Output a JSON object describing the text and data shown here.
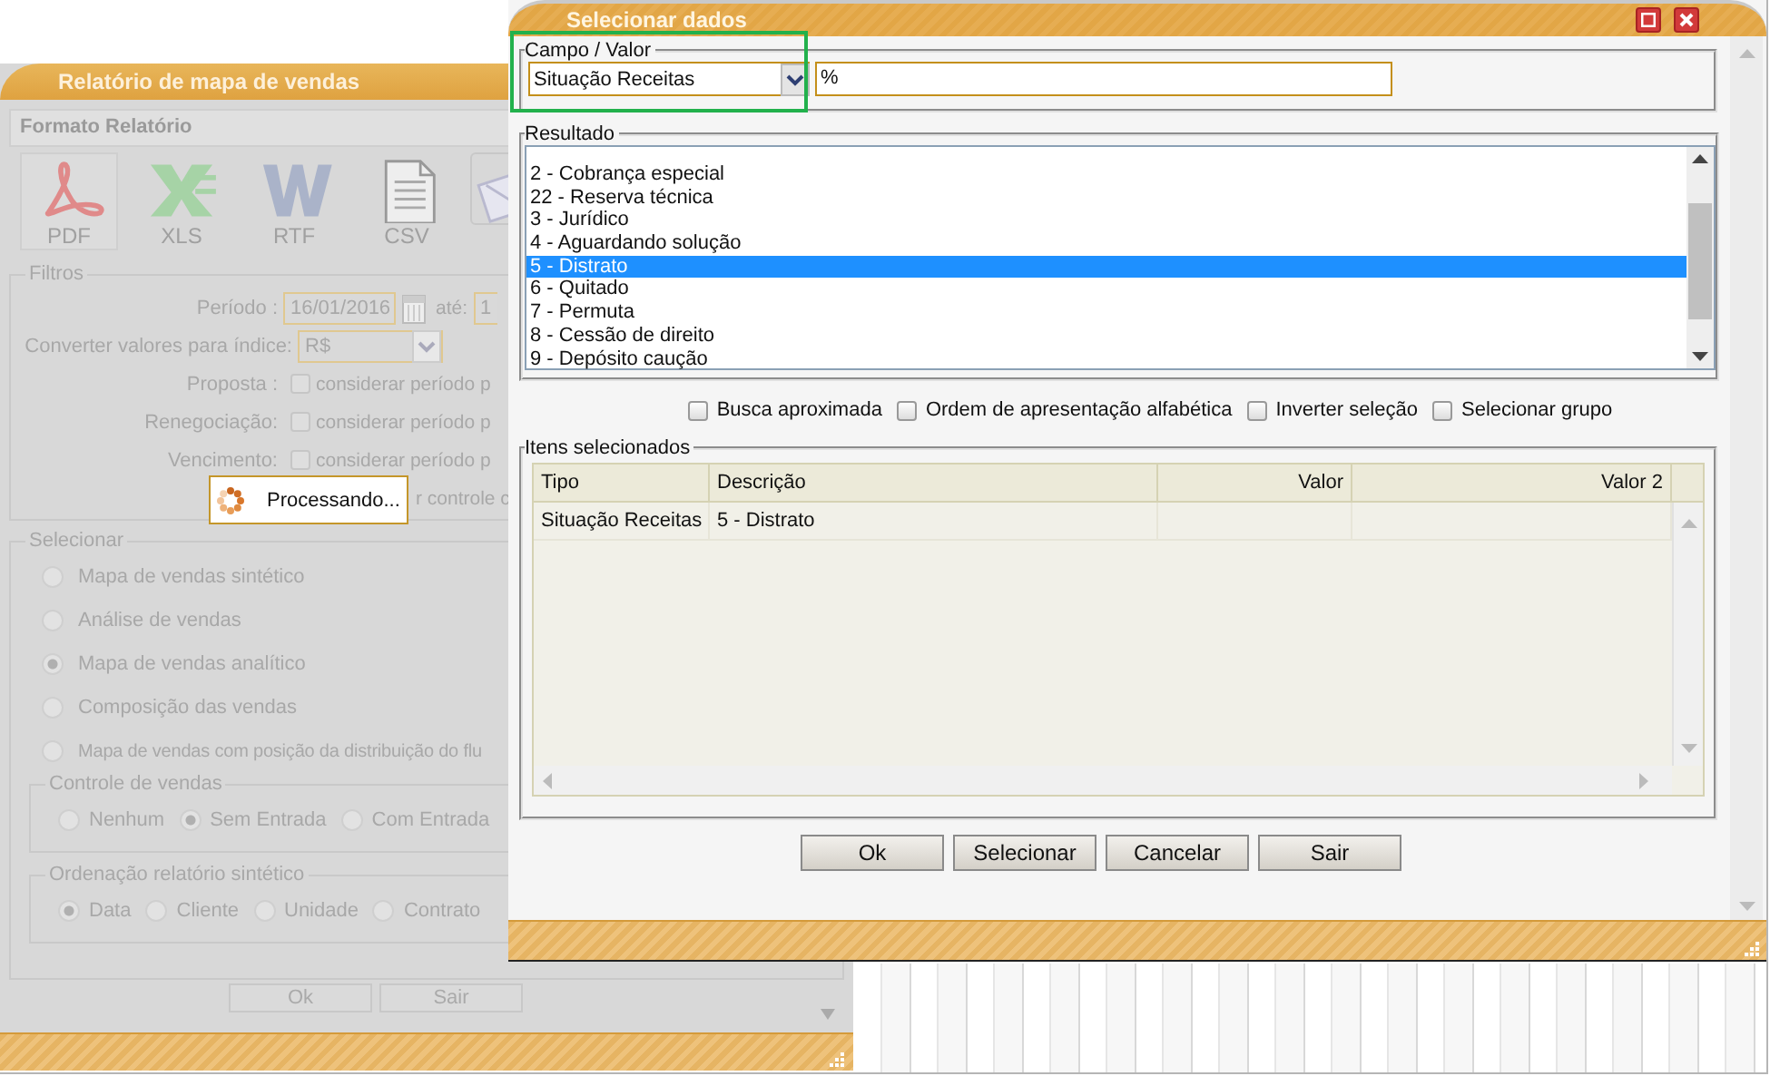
{
  "background_window": {
    "title": "Relatório de mapa de vendas",
    "format_section": {
      "title": "Formato Relatório",
      "formats": [
        {
          "kind": "pdf",
          "label": "PDF"
        },
        {
          "kind": "xls",
          "label": "XLS"
        },
        {
          "kind": "rtf",
          "label": "RTF"
        },
        {
          "kind": "csv",
          "label": "CSV"
        },
        {
          "kind": "email"
        }
      ]
    },
    "filters": {
      "legend": "Filtros",
      "period_label": "Período :",
      "period_start": "16/01/2016",
      "until_label": "até:",
      "period_end": "1",
      "index_label": "Converter valores para índice:",
      "index_value": "R$",
      "checks": [
        {
          "label": "Proposta :",
          "text": "considerar período p",
          "checked": false
        },
        {
          "label": "Renegociação:",
          "text": "considerar período p",
          "checked": false
        },
        {
          "label": "Vencimento:",
          "text": "considerar período p",
          "checked": false
        }
      ],
      "covered_text": "r controle c"
    },
    "select_section": {
      "legend": "Selecionar",
      "options": [
        {
          "label": "Mapa de vendas sintético",
          "selected": false
        },
        {
          "label": "Análise de vendas",
          "selected": false
        },
        {
          "label": "Mapa de vendas analítico",
          "selected": true
        },
        {
          "label": "Composição das vendas",
          "selected": false
        },
        {
          "label": "Mapa de vendas com posição da distribuição do flu",
          "selected": false
        }
      ],
      "sales_control": {
        "legend": "Controle de vendas",
        "options": [
          {
            "label": "Nenhum",
            "selected": false
          },
          {
            "label": "Sem Entrada",
            "selected": true
          },
          {
            "label": "Com Entrada",
            "selected": false
          }
        ]
      },
      "ordering": {
        "legend": "Ordenação relatório sintético",
        "options": [
          {
            "label": "Data",
            "selected": true
          },
          {
            "label": "Cliente",
            "selected": false
          },
          {
            "label": "Unidade",
            "selected": false
          },
          {
            "label": "Contrato",
            "selected": false
          }
        ]
      }
    },
    "buttons": [
      "Ok",
      "Sair"
    ]
  },
  "loading_popup": {
    "text": "Processando..."
  },
  "dialog": {
    "title": "Selecionar dados",
    "field_value": {
      "legend": "Campo / Valor",
      "field": "Situação Receitas",
      "value": "%"
    },
    "result": {
      "legend": "Resultado",
      "items": [
        {
          "text": "2  -  Cobrança especial",
          "selected": false
        },
        {
          "text": "22  -  Reserva técnica",
          "selected": false
        },
        {
          "text": "3  -  Jurídico",
          "selected": false
        },
        {
          "text": "4  -  Aguardando solução",
          "selected": false
        },
        {
          "text": "5  -  Distrato",
          "selected": true
        },
        {
          "text": "6  -  Quitado",
          "selected": false
        },
        {
          "text": "7  -  Permuta",
          "selected": false
        },
        {
          "text": "8  -  Cessão de direito",
          "selected": false
        },
        {
          "text": "9  -  Depósito caução",
          "selected": false
        }
      ]
    },
    "options": [
      {
        "label": "Busca aproximada",
        "checked": false
      },
      {
        "label": "Ordem de apresentação alfabética",
        "checked": false
      },
      {
        "label": "Inverter seleção",
        "checked": false
      },
      {
        "label": "Selecionar grupo",
        "checked": false
      }
    ],
    "selected_items": {
      "legend": "Itens selecionados",
      "columns": [
        "Tipo",
        "Descrição",
        "Valor",
        "Valor 2"
      ],
      "rows": [
        [
          "Situação Receitas",
          "5 - Distrato"
        ]
      ]
    },
    "buttons": [
      "Ok",
      "Selecionar",
      "Cancelar",
      "Sair"
    ]
  }
}
